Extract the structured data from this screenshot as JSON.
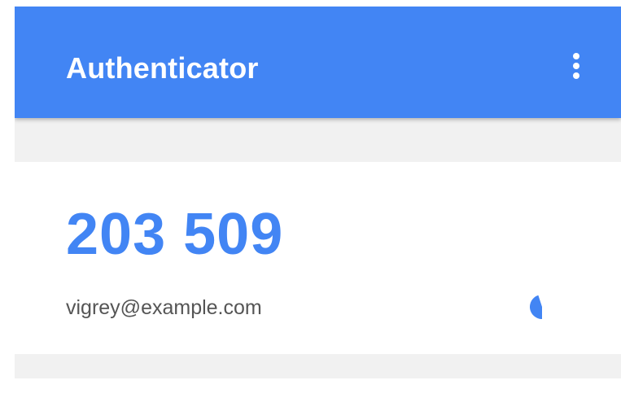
{
  "app_bar": {
    "title": "Authenticator",
    "menu_icon": "more-vert-icon",
    "color": "#4285f4"
  },
  "account": {
    "code": "203 509",
    "label": "vigrey@example.com",
    "code_color": "#4285f4",
    "countdown_remaining": 0.45,
    "countdown_icon": "timer-pie-icon"
  }
}
